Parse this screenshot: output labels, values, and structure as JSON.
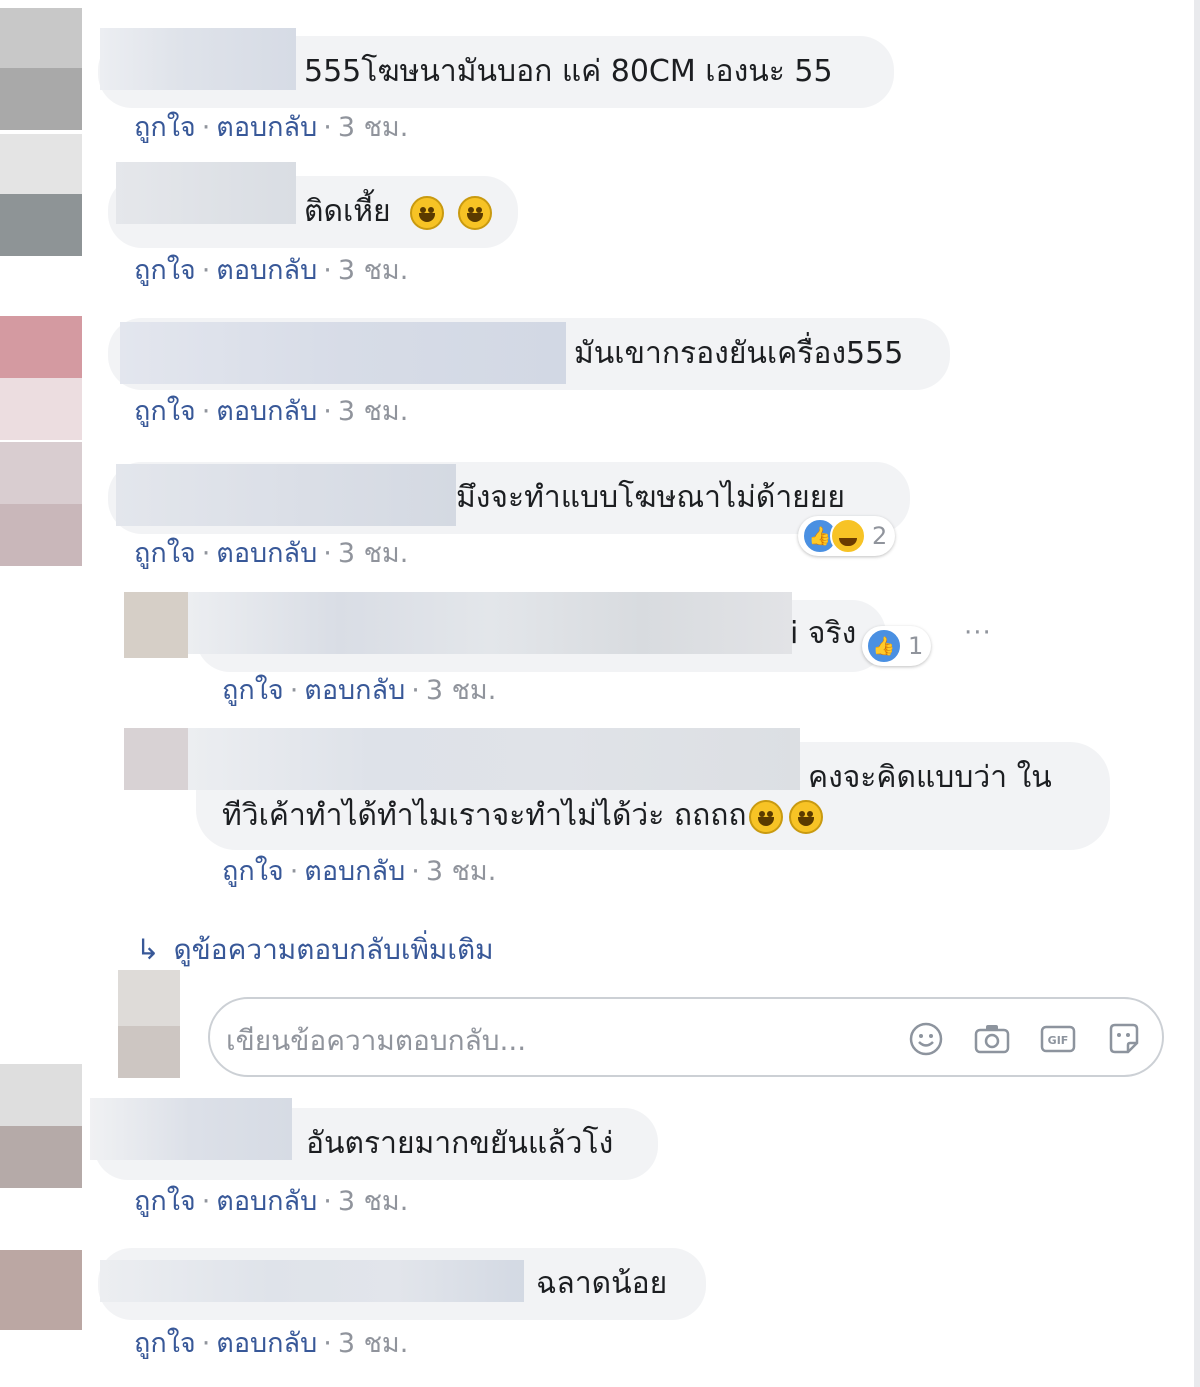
{
  "comments": [
    {
      "text": "555โฆษนามันบอก แค่ 80CM เองนะ 55",
      "time": "3 ชม."
    },
    {
      "text": "ติดเหี้ย",
      "time": "3 ชม."
    },
    {
      "text": "มันเขากรองยันเครื่อง555",
      "time": "3 ชม."
    },
    {
      "text": "มึงจะทำแบบโฆษณาไม่ด้ายยย",
      "time": "3 ชม.",
      "reaction_count": "2"
    },
    {
      "text": "i จริง",
      "time": "3 ชม.",
      "reaction_count": "1"
    },
    {
      "text_line1": "คงจะคิดแบบว่า ใน",
      "text_line2": "ทีวิเค้าทำได้ทำไมเราจะทำไม่ได้ว่ะ ถถถถ",
      "time": "3 ชม."
    },
    {
      "text": "อันตรายมากขยันแล้วโง่",
      "time": "3 ชม."
    },
    {
      "text": "ฉลาดน้อย",
      "time": "3 ชม."
    }
  ],
  "actions": {
    "like": "ถูกใจ",
    "reply": "ตอบกลับ",
    "separator": "·"
  },
  "more_replies": "ดูข้อความตอบกลับเพิ่มเติม",
  "reply_box": {
    "placeholder": "เขียนข้อความตอบกลับ..."
  },
  "icons": {
    "emoji": "smiley-icon",
    "camera": "camera-icon",
    "gif": "gif-icon",
    "sticker": "sticker-icon",
    "like_reaction": "thumbs-up-icon",
    "haha_reaction": "laughing-face-icon",
    "more_options": "ellipsis-icon",
    "reply_arrow": "reply-arrow-icon"
  },
  "colors": {
    "link": "#385898",
    "bubble": "#f2f3f5",
    "like_blue": "#4a90e2",
    "muted": "#90949c"
  }
}
